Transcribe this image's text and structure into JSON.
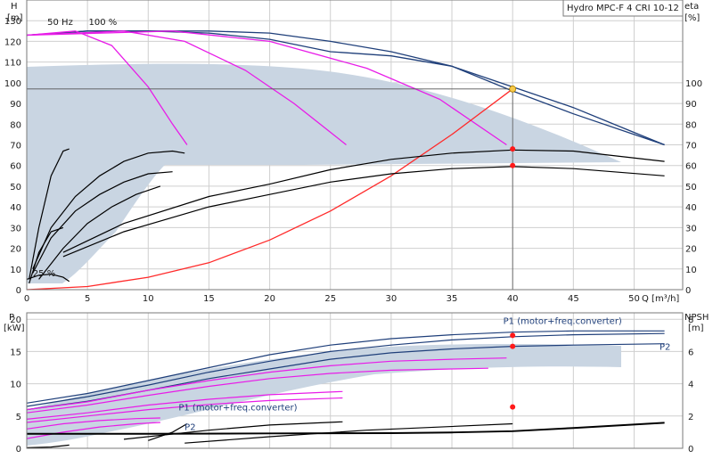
{
  "chart_data": [
    {
      "type": "line",
      "title": "Hydro MPC-F 4 CRI 10-12",
      "xlabel": "Q [m³/h]",
      "ylabel": "H [m]",
      "y2label": "eta [%]",
      "xlim": [
        0,
        54
      ],
      "ylim": [
        0,
        140
      ],
      "y2lim": [
        0,
        140
      ],
      "xticks": [
        0,
        5,
        10,
        15,
        20,
        25,
        30,
        35,
        40,
        45,
        50
      ],
      "yticks": [
        0,
        10,
        20,
        30,
        40,
        50,
        60,
        70,
        80,
        90,
        100,
        110,
        120,
        130
      ],
      "y2ticks": [
        0,
        10,
        20,
        30,
        40,
        50,
        60,
        70,
        80,
        90,
        100
      ],
      "grid": true,
      "annotations": [
        "50 Hz",
        "100 %",
        "25 %"
      ],
      "duty_point": {
        "x": 40,
        "y": 97
      },
      "efficiency_points": [
        {
          "x": 40,
          "y": 68
        },
        {
          "x": 40,
          "y": 60
        }
      ],
      "series": [
        {
          "color": "#1f3f7a",
          "x": [
            0,
            5,
            10,
            15,
            20,
            25,
            30,
            35,
            40,
            45,
            50,
            52.5
          ],
          "y": [
            123,
            125,
            125,
            125,
            124,
            120,
            115,
            108,
            98,
            88,
            76,
            70
          ]
        },
        {
          "color": "#1f3f7a",
          "x": [
            0,
            5,
            10,
            15,
            20,
            25,
            30,
            35,
            40,
            45,
            50,
            52.5
          ],
          "y": [
            123,
            125,
            125,
            124,
            121,
            115,
            113,
            108,
            96,
            85,
            75,
            70
          ]
        },
        {
          "color": "#e81ce8",
          "x": [
            0,
            4,
            7,
            10,
            12,
            13.2
          ],
          "y": [
            123,
            125,
            118,
            98,
            80,
            70
          ]
        },
        {
          "color": "#e81ce8",
          "x": [
            0,
            8,
            13,
            18,
            22,
            26.3
          ],
          "y": [
            123,
            125,
            120,
            106,
            90,
            70
          ]
        },
        {
          "color": "#e81ce8",
          "x": [
            0,
            12,
            20,
            28,
            34,
            39.5
          ],
          "y": [
            123,
            125,
            120,
            107,
            92,
            70
          ]
        },
        {
          "color": "#ff2a2a",
          "x": [
            0,
            5,
            10,
            15,
            20,
            25,
            30,
            35,
            40
          ],
          "y": [
            0,
            1.5,
            6,
            13,
            24,
            38,
            55,
            75,
            97
          ]
        },
        {
          "color": "#000000",
          "x": [
            3,
            8,
            15,
            20,
            25,
            30,
            35,
            40,
            45,
            52.5
          ],
          "y": [
            18,
            32,
            45,
            51,
            58,
            63,
            66,
            67.5,
            67,
            62
          ]
        },
        {
          "color": "#000000",
          "x": [
            3,
            8,
            15,
            20,
            25,
            30,
            35,
            40,
            45,
            52.5
          ],
          "y": [
            16,
            28,
            40,
            46,
            52,
            56,
            58.5,
            59.5,
            58.5,
            55
          ]
        },
        {
          "color": "#000000",
          "x": [
            0.5,
            2,
            4,
            6,
            8,
            10,
            12,
            13
          ],
          "y": [
            10,
            30,
            45,
            55,
            62,
            66,
            67,
            66
          ]
        },
        {
          "color": "#000000",
          "x": [
            0.5,
            2,
            4,
            6,
            8,
            10,
            12
          ],
          "y": [
            8,
            25,
            38,
            46,
            52,
            56,
            57
          ]
        },
        {
          "color": "#000000",
          "x": [
            1,
            3,
            5,
            7,
            9,
            11
          ],
          "y": [
            5,
            20,
            32,
            40,
            46,
            50
          ]
        },
        {
          "color": "#000000",
          "x": [
            0.2,
            1,
            2,
            3,
            3.5
          ],
          "y": [
            5,
            30,
            55,
            67,
            68
          ]
        },
        {
          "color": "#000000",
          "x": [
            0.2,
            1,
            2,
            3
          ],
          "y": [
            3,
            18,
            28,
            30
          ]
        },
        {
          "color": "#000000",
          "x": [
            0,
            1,
            2,
            3,
            3.5
          ],
          "y": [
            5,
            7,
            7.5,
            6,
            4
          ]
        }
      ]
    },
    {
      "type": "line",
      "xlabel": "",
      "ylabel": "P [kW]",
      "y2label": "NPSH [m]",
      "xlim": [
        0,
        54
      ],
      "ylim": [
        0,
        21
      ],
      "y2lim": [
        0,
        8.4
      ],
      "yticks": [
        0,
        5,
        10,
        15,
        20
      ],
      "y2ticks": [
        0,
        2,
        4,
        6,
        8
      ],
      "grid": true,
      "labels": [
        {
          "text": "P1 (motor+freq.converter)",
          "x": 49,
          "y": 19.3
        },
        {
          "text": "P2",
          "x": 53,
          "y": 15.3
        },
        {
          "text": "P1 (motor+freq.converter)",
          "x": 12.5,
          "y": 5.9
        },
        {
          "text": "P2",
          "x": 13,
          "y": 2.8
        }
      ],
      "markers": [
        {
          "x": 40,
          "y": 17.5
        },
        {
          "x": 40,
          "y": 15.8
        },
        {
          "x": 40,
          "y": 6.4
        }
      ],
      "series": [
        {
          "color": "#1f3f7a",
          "x": [
            0,
            5,
            10,
            15,
            20,
            25,
            30,
            35,
            40,
            45,
            52.5
          ],
          "y": [
            7,
            8.5,
            10.5,
            12.5,
            14.5,
            16,
            17,
            17.6,
            18,
            18.2,
            18.2
          ]
        },
        {
          "color": "#1f3f7a",
          "x": [
            0,
            5,
            10,
            15,
            20,
            25,
            30,
            35,
            40,
            45,
            52.5
          ],
          "y": [
            6.5,
            8,
            9.8,
            11.8,
            13.5,
            15,
            16,
            16.8,
            17.3,
            17.6,
            17.8
          ]
        },
        {
          "color": "#1f3f7a",
          "x": [
            0,
            5,
            10,
            15,
            20,
            25,
            30,
            35,
            40,
            45,
            52.5
          ],
          "y": [
            6,
            7.3,
            9,
            10.8,
            12.3,
            13.8,
            14.8,
            15.4,
            15.8,
            16,
            16.2
          ]
        },
        {
          "color": "#e81ce8",
          "x": [
            0,
            5,
            10,
            15,
            20,
            25,
            30,
            35,
            39.5
          ],
          "y": [
            6,
            7.2,
            9,
            10.5,
            11.8,
            12.8,
            13.5,
            13.8,
            14
          ]
        },
        {
          "color": "#e81ce8",
          "x": [
            0,
            5,
            10,
            15,
            20,
            25,
            30,
            35,
            38
          ],
          "y": [
            5.5,
            6.7,
            8.2,
            9.6,
            10.8,
            11.6,
            12.1,
            12.3,
            12.4
          ]
        },
        {
          "color": "#e81ce8",
          "x": [
            0,
            5,
            10,
            15,
            20,
            26
          ],
          "y": [
            4.5,
            5.5,
            6.7,
            7.6,
            8.3,
            8.8
          ]
        },
        {
          "color": "#e81ce8",
          "x": [
            0,
            5,
            10,
            15,
            20,
            26
          ],
          "y": [
            4,
            5,
            6,
            6.8,
            7.4,
            7.8
          ]
        },
        {
          "color": "#e81ce8",
          "x": [
            0,
            3,
            6,
            9,
            11
          ],
          "y": [
            3,
            3.8,
            4.3,
            4.6,
            4.7
          ]
        },
        {
          "color": "#e81ce8",
          "x": [
            0,
            3,
            6,
            9,
            11
          ],
          "y": [
            1.5,
            2.5,
            3.3,
            3.8,
            4
          ]
        },
        {
          "color": "#000000",
          "x": [
            0,
            10,
            20,
            30,
            35,
            40,
            45,
            52.5
          ],
          "y": [
            2.2,
            2.2,
            2.25,
            2.3,
            2.4,
            2.6,
            3.1,
            3.9
          ]
        },
        {
          "color": "#000000",
          "x": [
            0,
            10,
            20,
            30,
            35,
            40,
            45,
            52.5
          ],
          "y": [
            2.3,
            2.3,
            2.35,
            2.4,
            2.5,
            2.7,
            3.2,
            4
          ]
        },
        {
          "color": "#000000",
          "x": [
            8,
            15,
            20,
            26
          ],
          "y": [
            1.4,
            2.8,
            3.6,
            4.1
          ]
        },
        {
          "color": "#000000",
          "x": [
            13,
            20,
            28,
            40
          ],
          "y": [
            0.8,
            1.8,
            2.8,
            3.8
          ]
        },
        {
          "color": "#000000",
          "x": [
            10,
            12,
            13.2
          ],
          "y": [
            1.2,
            2.5,
            3.8
          ]
        },
        {
          "color": "#000000",
          "x": [
            0,
            2,
            3.5
          ],
          "y": [
            0.1,
            0.2,
            0.5
          ]
        }
      ]
    }
  ]
}
